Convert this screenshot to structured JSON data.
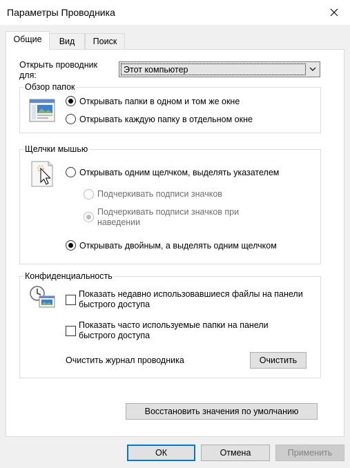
{
  "window": {
    "title": "Параметры Проводника",
    "close_icon": "close-icon"
  },
  "tabs": [
    {
      "label": "Общие",
      "active": true
    },
    {
      "label": "Вид",
      "active": false
    },
    {
      "label": "Поиск",
      "active": false
    }
  ],
  "open_explorer": {
    "label": "Открыть проводник для:",
    "value": "Этот компьютер"
  },
  "browse_folders": {
    "title": "Обзор папок",
    "icon": "folder-window-icon",
    "options": [
      {
        "label": "Открывать папки в одном и том же окне",
        "checked": true
      },
      {
        "label": "Открывать каждую папку в отдельном окне",
        "checked": false
      }
    ]
  },
  "clicks": {
    "title": "Щелчки мышью",
    "icon": "mouse-pointer-icon",
    "single_click": {
      "label": "Открывать одним щелчком, выделять указателем",
      "checked": false
    },
    "underline_always": {
      "label": "Подчеркивать подписи значков",
      "checked": false
    },
    "underline_hover": {
      "label": "Подчеркивать подписи значков при наведении",
      "checked": true
    },
    "double_click": {
      "label": "Открывать двойным, а выделять одним щелчком",
      "checked": true
    }
  },
  "privacy": {
    "title": "Конфиденциальность",
    "icon": "privacy-clock-icon",
    "recent_files": {
      "label": "Показать недавно использовавшиеся файлы на панели быстрого доступа",
      "checked": false
    },
    "frequent_folders": {
      "label": "Показать часто используемые папки на панели быстрого доступа",
      "checked": false
    },
    "clear_label": "Очистить журнал проводника",
    "clear_button": "Очистить"
  },
  "restore_button": "Восстановить значения по умолчанию",
  "footer": {
    "ok": "ОК",
    "cancel": "Отмена",
    "apply": "Применить"
  },
  "colors": {
    "accent": "#0078d7",
    "disabled_text": "#6d6d6d",
    "dialog_bg": "#f0f0f0"
  }
}
